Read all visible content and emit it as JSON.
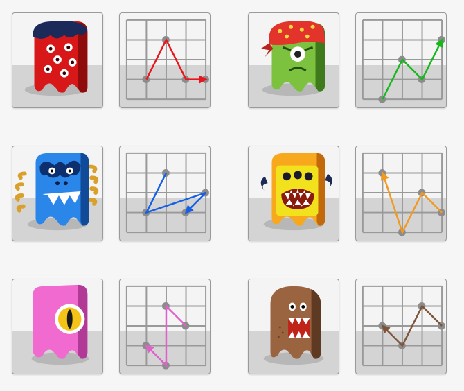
{
  "grid": {
    "cols": 4,
    "rows": 4,
    "line_color": "#999999",
    "dot_color": "#8c8c8c"
  },
  "puzzles": [
    {
      "monster": {
        "name": "red-monster",
        "body": "#d81818",
        "dark": "#8e0c0c",
        "hair": "#1c2a5a"
      },
      "pattern": {
        "color": "#e8161c",
        "points": [
          [
            1,
            3
          ],
          [
            2,
            1
          ],
          [
            3,
            3
          ],
          [
            4,
            3
          ]
        ]
      }
    },
    {
      "monster": {
        "name": "green-monster",
        "body": "#7cc23e",
        "dark": "#3f7a1c",
        "bandana": "#e3342b"
      },
      "pattern": {
        "color": "#17b81c",
        "points": [
          [
            1,
            4
          ],
          [
            2,
            2
          ],
          [
            3,
            3
          ],
          [
            4,
            1
          ]
        ]
      }
    },
    {
      "monster": {
        "name": "blue-monster",
        "body": "#2a86e8",
        "dark": "#104a99",
        "horns": "#d9a12c"
      },
      "pattern": {
        "color": "#1560e6",
        "points": [
          [
            2,
            1
          ],
          [
            1,
            3
          ],
          [
            4,
            2
          ],
          [
            3,
            3
          ]
        ]
      }
    },
    {
      "monster": {
        "name": "orange-monster",
        "body": "#f7a81c",
        "dark": "#c2690c",
        "face": "#f2e21e"
      },
      "pattern": {
        "color": "#f09a20",
        "points": [
          [
            4,
            3
          ],
          [
            3,
            2
          ],
          [
            2,
            4
          ],
          [
            1,
            1
          ]
        ]
      }
    },
    {
      "monster": {
        "name": "pink-monster",
        "body": "#f06ad0",
        "dark": "#b03a96",
        "eye": "#f3c318"
      },
      "pattern": {
        "color": "#e060cc",
        "points": [
          [
            3,
            2
          ],
          [
            2,
            1
          ],
          [
            2,
            4
          ],
          [
            1,
            3
          ]
        ]
      }
    },
    {
      "monster": {
        "name": "brown-monster",
        "body": "#9b6440",
        "dark": "#5e3a22"
      },
      "pattern": {
        "color": "#7d553a",
        "points": [
          [
            4,
            2
          ],
          [
            3,
            1
          ],
          [
            2,
            3
          ],
          [
            1,
            2
          ]
        ]
      }
    }
  ]
}
